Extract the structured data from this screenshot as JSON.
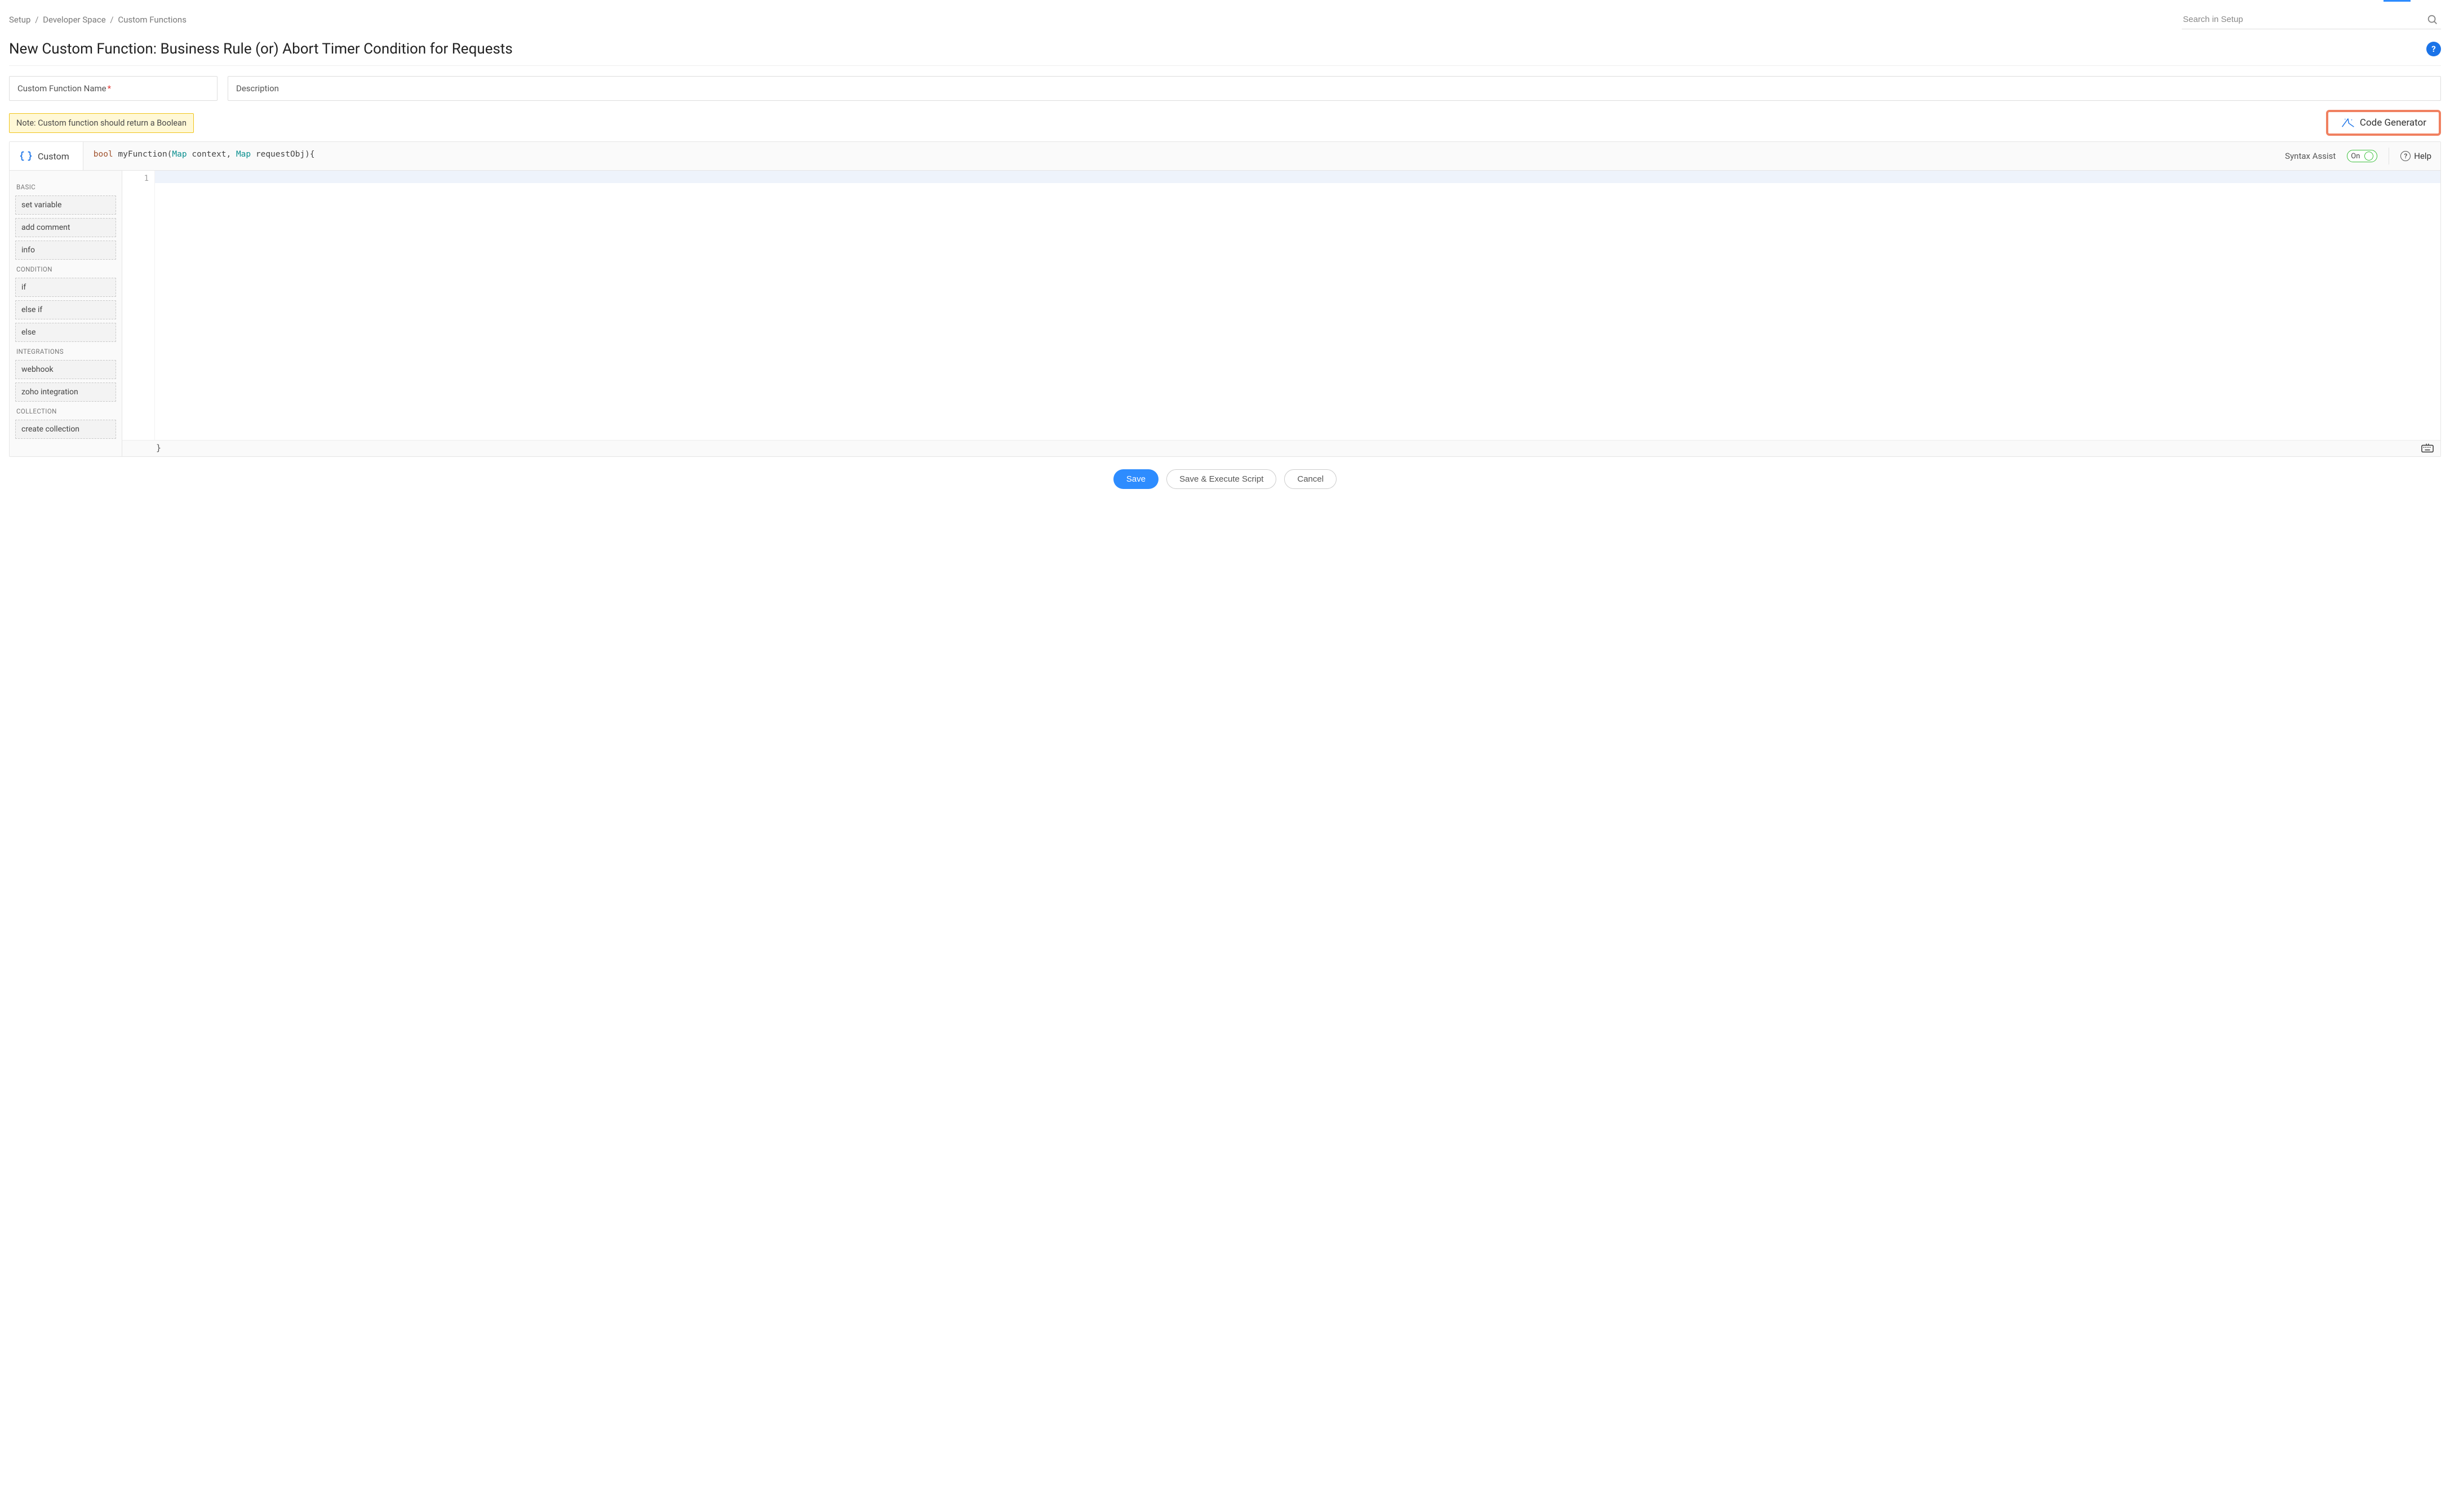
{
  "breadcrumbs": {
    "items": [
      "Setup",
      "Developer Space",
      "Custom Functions"
    ]
  },
  "search": {
    "placeholder": "Search in Setup",
    "value": ""
  },
  "page": {
    "title": "New Custom Function: Business Rule (or) Abort Timer Condition for Requests"
  },
  "form": {
    "name_label": "Custom Function Name",
    "description_label": "Description"
  },
  "note": {
    "text": "Note: Custom function should return a Boolean"
  },
  "codegen": {
    "label": "Code Generator"
  },
  "editor_header": {
    "custom_tab": "Custom",
    "syntax_assist_label": "Syntax Assist",
    "toggle_state": "On",
    "help_label": "Help",
    "signature_tokens": {
      "bool": "bool",
      "fn_open": " myFunction(",
      "map1": "Map",
      "ctx": " context, ",
      "map2": "Map",
      "req": " requestObj){"
    }
  },
  "palette": {
    "groups": [
      {
        "title": "BASIC",
        "items": [
          "set variable",
          "add comment",
          "info"
        ]
      },
      {
        "title": "CONDITION",
        "items": [
          "if",
          "else if",
          "else"
        ]
      },
      {
        "title": "INTEGRATIONS",
        "items": [
          "webhook",
          "zoho integration"
        ]
      },
      {
        "title": "COLLECTION",
        "items": [
          "create collection"
        ]
      }
    ]
  },
  "code": {
    "line_numbers": [
      "1"
    ],
    "closing_brace": "}"
  },
  "footer": {
    "save": "Save",
    "save_exec": "Save & Execute Script",
    "cancel": "Cancel"
  }
}
